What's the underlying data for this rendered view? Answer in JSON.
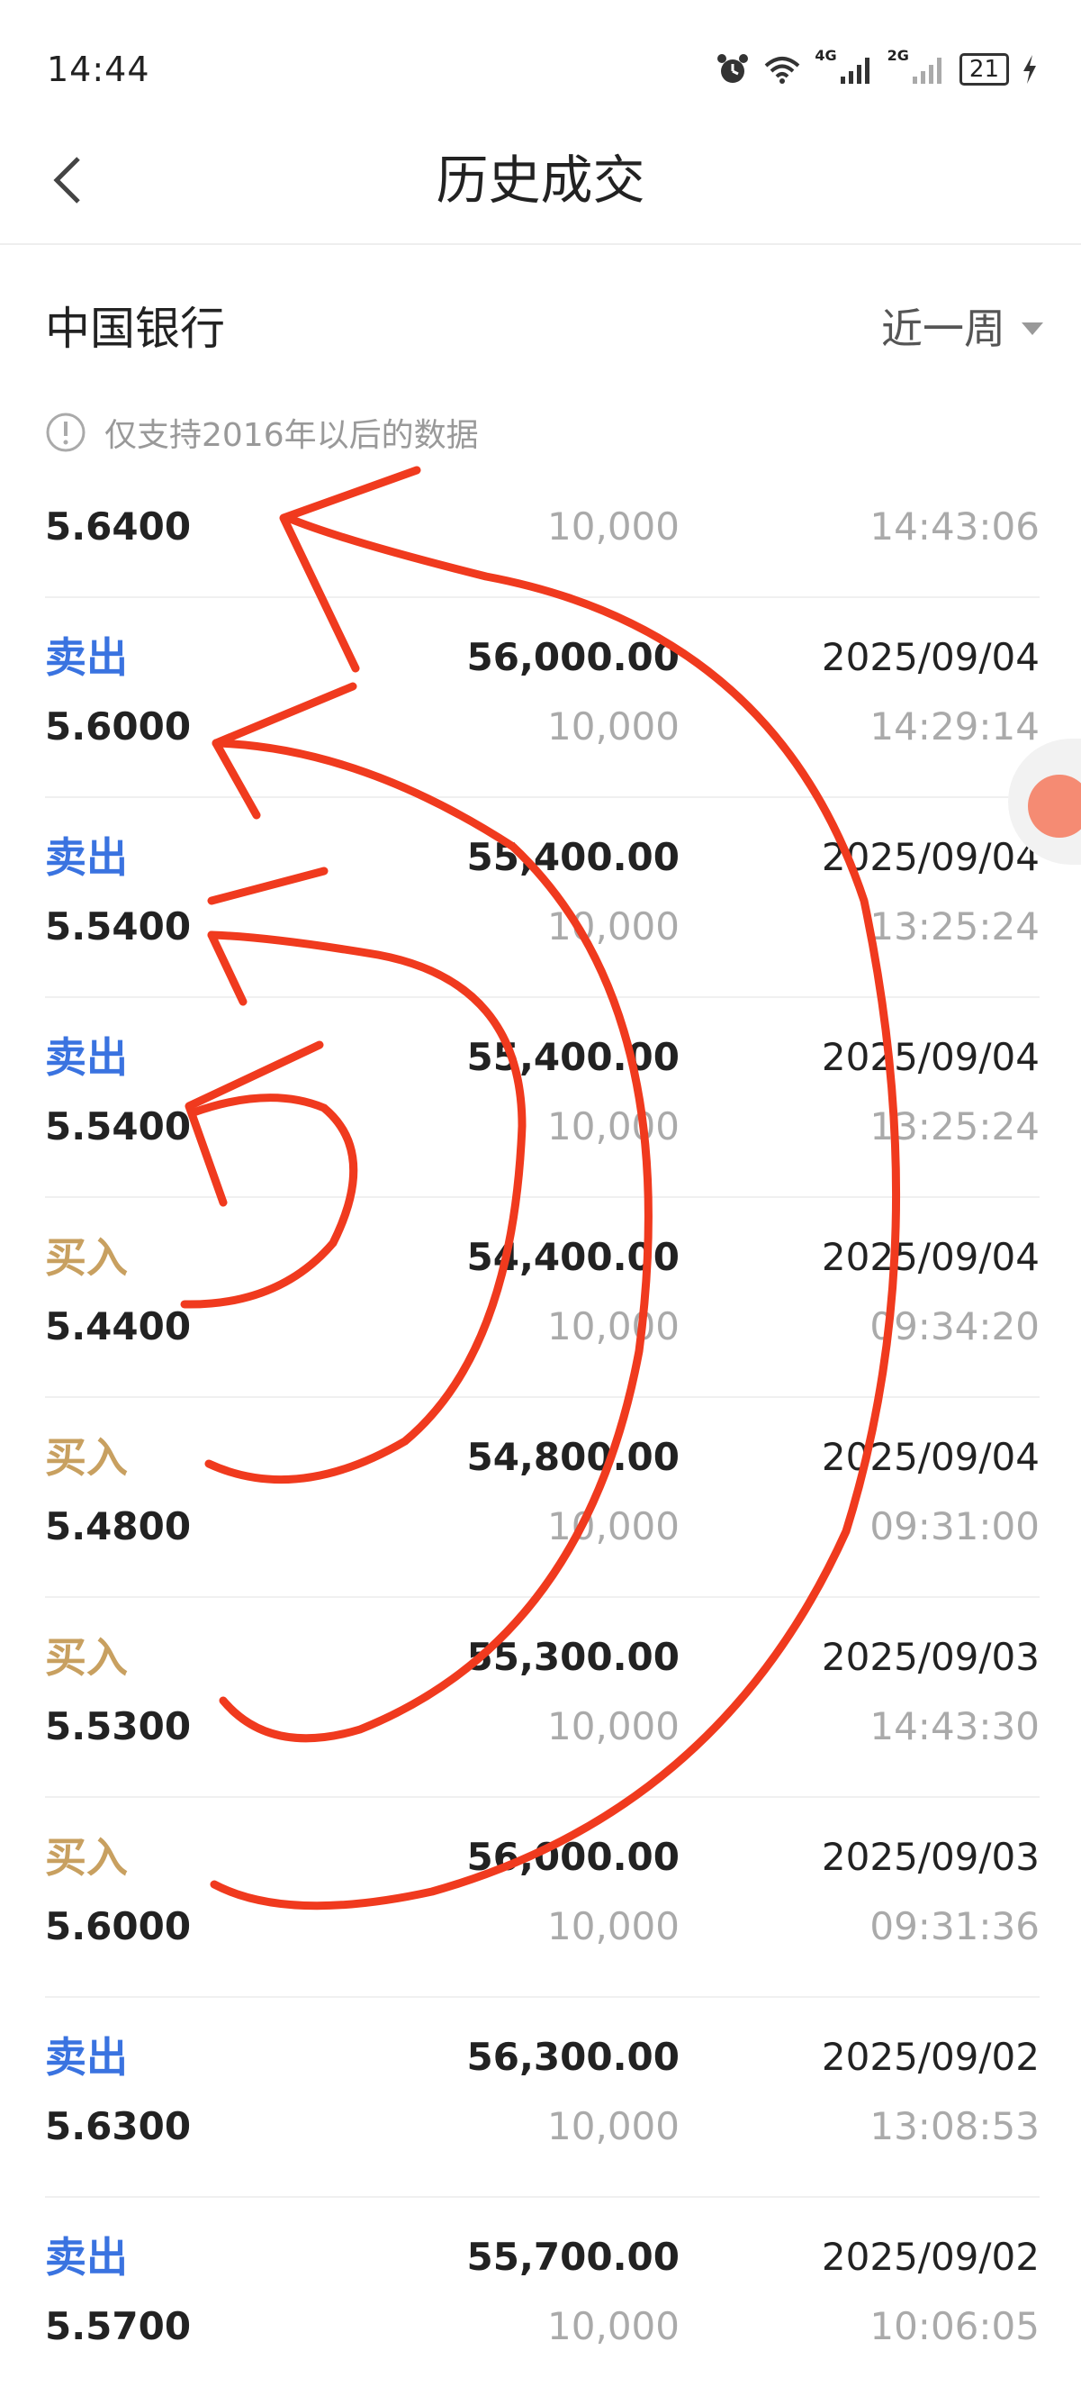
{
  "status_bar": {
    "time": "14:44",
    "net1": "4G",
    "net2": "2G",
    "battery": "21"
  },
  "header": {
    "title": "历史成交"
  },
  "stock": {
    "name": "中国银行",
    "period": "近一周"
  },
  "notice": "仅支持2016年以后的数据",
  "trades": [
    {
      "type": "",
      "price": "5.6400",
      "amount": "",
      "qty": "10,000",
      "date": "",
      "time": "14:43:06"
    },
    {
      "type": "卖出",
      "price": "5.6000",
      "amount": "56,000.00",
      "qty": "10,000",
      "date": "2025/09/04",
      "time": "14:29:14"
    },
    {
      "type": "卖出",
      "price": "5.5400",
      "amount": "55,400.00",
      "qty": "10,000",
      "date": "2025/09/04",
      "time": "13:25:24"
    },
    {
      "type": "卖出",
      "price": "5.5400",
      "amount": "55,400.00",
      "qty": "10,000",
      "date": "2025/09/04",
      "time": "13:25:24"
    },
    {
      "type": "买入",
      "price": "5.4400",
      "amount": "54,400.00",
      "qty": "10,000",
      "date": "2025/09/04",
      "time": "09:34:20"
    },
    {
      "type": "买入",
      "price": "5.4800",
      "amount": "54,800.00",
      "qty": "10,000",
      "date": "2025/09/04",
      "time": "09:31:00"
    },
    {
      "type": "买入",
      "price": "5.5300",
      "amount": "55,300.00",
      "qty": "10,000",
      "date": "2025/09/03",
      "time": "14:43:30"
    },
    {
      "type": "买入",
      "price": "5.6000",
      "amount": "56,000.00",
      "qty": "10,000",
      "date": "2025/09/03",
      "time": "09:31:36"
    },
    {
      "type": "卖出",
      "price": "5.6300",
      "amount": "56,300.00",
      "qty": "10,000",
      "date": "2025/09/02",
      "time": "13:08:53"
    },
    {
      "type": "卖出",
      "price": "5.5700",
      "amount": "55,700.00",
      "qty": "10,000",
      "date": "2025/09/02",
      "time": "10:06:05"
    }
  ],
  "colors": {
    "sell": "#3a73e0",
    "buy": "#c8a060",
    "annotation": "#f03a1e"
  }
}
